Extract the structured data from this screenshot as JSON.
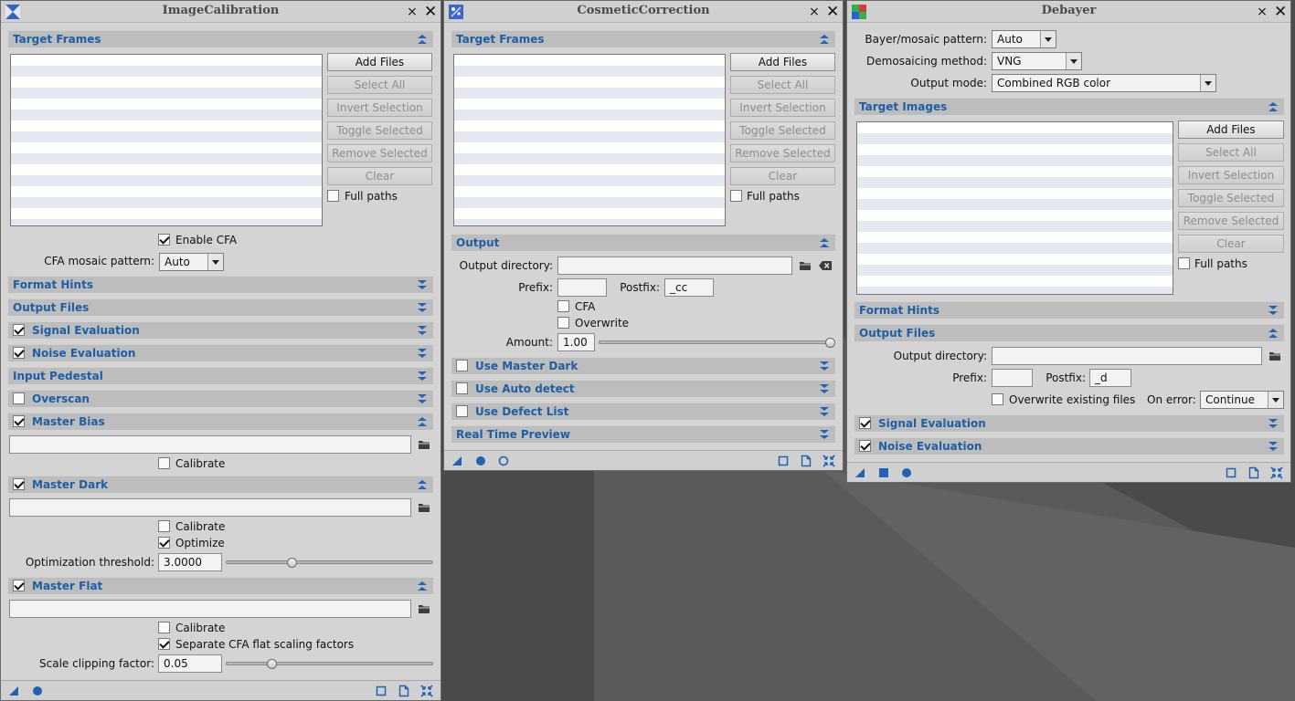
{
  "colors": {
    "desktop": "#4a4a4a",
    "window_bg": "#d4d4d4",
    "section_bar": "#bdbdbd",
    "section_text": "#1d5fa6",
    "icon_blue": "#1f63b2",
    "list_stripe": "#e5e8ee"
  },
  "image_calibration": {
    "title": "ImageCalibration",
    "target_frames": {
      "header": "Target Frames",
      "add_files": "Add Files",
      "select_all": "Select All",
      "invert_selection": "Invert Selection",
      "toggle_selected": "Toggle Selected",
      "remove_selected": "Remove Selected",
      "clear": "Clear",
      "full_paths": "Full paths"
    },
    "enable_cfa": "Enable CFA",
    "cfa_pattern_label": "CFA mosaic pattern:",
    "cfa_pattern_value": "Auto",
    "sections": {
      "format_hints": "Format Hints",
      "output_files": "Output Files",
      "signal_evaluation": "Signal Evaluation",
      "noise_evaluation": "Noise Evaluation",
      "input_pedestal": "Input Pedestal",
      "overscan": "Overscan",
      "master_bias": "Master Bias",
      "master_dark": "Master Dark",
      "master_flat": "Master Flat"
    },
    "calibrate": "Calibrate",
    "optimize": "Optimize",
    "optimization_threshold_label": "Optimization threshold:",
    "optimization_threshold_value": "3.0000",
    "optimization_slider_fraction": 0.31,
    "separate_cfa": "Separate CFA flat scaling factors",
    "scale_clipping_label": "Scale clipping factor:",
    "scale_clipping_value": "0.05",
    "scale_slider_fraction": 0.21
  },
  "cosmetic_correction": {
    "title": "CosmeticCorrection",
    "target_frames": {
      "header": "Target Frames",
      "add_files": "Add Files",
      "select_all": "Select All",
      "invert_selection": "Invert Selection",
      "toggle_selected": "Toggle Selected",
      "remove_selected": "Remove Selected",
      "clear": "Clear",
      "full_paths": "Full paths"
    },
    "output": {
      "header": "Output",
      "dir_label": "Output directory:",
      "prefix_label": "Prefix:",
      "prefix_value": "",
      "postfix_label": "Postfix:",
      "postfix_value": "_cc",
      "cfa": "CFA",
      "overwrite": "Overwrite",
      "amount_label": "Amount:",
      "amount_value": "1.00",
      "amount_fraction": 1.0
    },
    "sections": {
      "use_master_dark": "Use Master Dark",
      "use_auto_detect": "Use Auto detect",
      "use_defect_list": "Use Defect List",
      "real_time_preview": "Real Time Preview"
    }
  },
  "debayer": {
    "title": "Debayer",
    "bayer_label": "Bayer/mosaic pattern:",
    "bayer_value": "Auto",
    "demosaic_label": "Demosaicing method:",
    "demosaic_value": "VNG",
    "output_mode_label": "Output mode:",
    "output_mode_value": "Combined RGB color",
    "target_images": {
      "header": "Target Images",
      "add_files": "Add Files",
      "select_all": "Select All",
      "invert_selection": "Invert Selection",
      "toggle_selected": "Toggle Selected",
      "remove_selected": "Remove Selected",
      "clear": "Clear",
      "full_paths": "Full paths"
    },
    "sections": {
      "format_hints": "Format Hints",
      "output_files": "Output Files",
      "signal_evaluation": "Signal Evaluation",
      "noise_evaluation": "Noise Evaluation"
    },
    "output_files": {
      "dir_label": "Output directory:",
      "prefix_label": "Prefix:",
      "prefix_value": "",
      "postfix_label": "Postfix:",
      "postfix_value": "_d",
      "overwrite": "Overwrite existing files",
      "on_error_label": "On error:",
      "on_error_value": "Continue"
    }
  }
}
